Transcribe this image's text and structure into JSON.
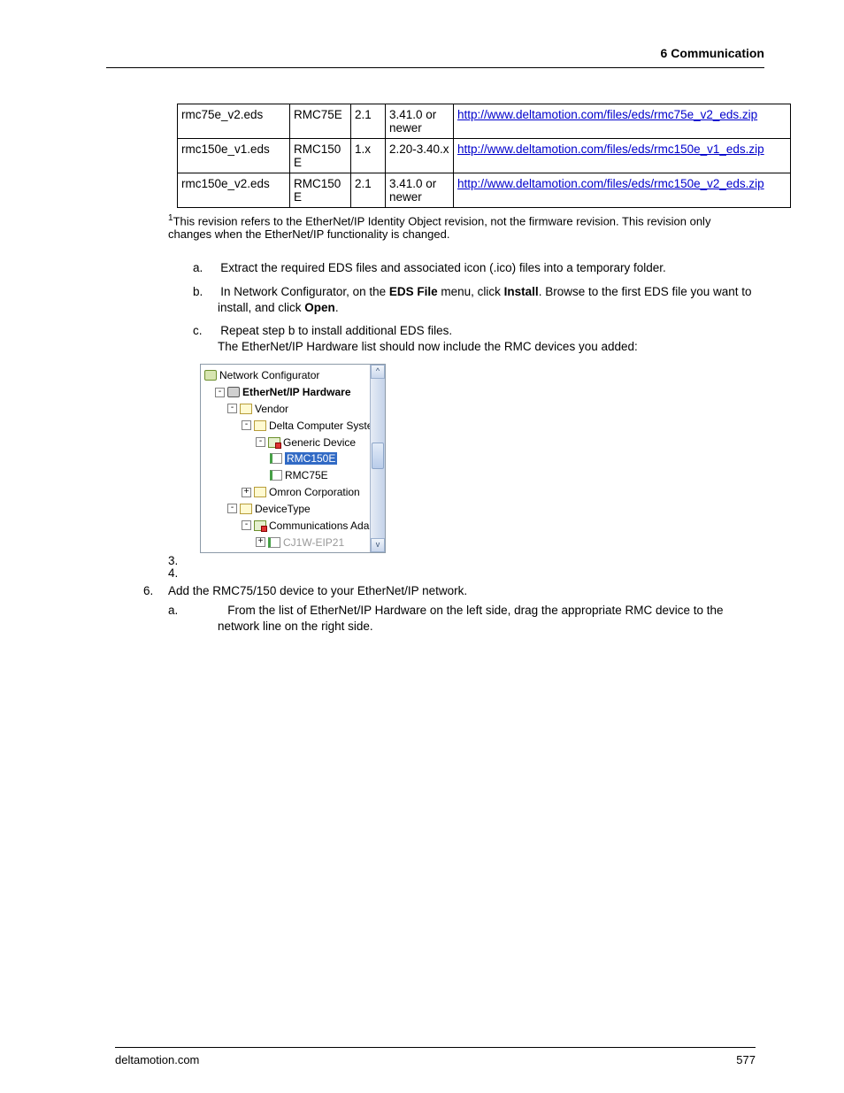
{
  "header": {
    "chapter": "6  Communication"
  },
  "table": {
    "rows": [
      {
        "file": "rmc75e_v2.eds",
        "device": "RMC75E",
        "rev": "2.1",
        "fw": "3.41.0 or newer",
        "url": "http://www.deltamotion.com/files/eds/rmc75e_v2_eds.zip"
      },
      {
        "file": "rmc150e_v1.eds",
        "device": "RMC150E",
        "rev": "1.x",
        "fw": "2.20-3.40.x",
        "url": "http://www.deltamotion.com/files/eds/rmc150e_v1_eds.zip"
      },
      {
        "file": "rmc150e_v2.eds",
        "device": "RMC150E",
        "rev": "2.1",
        "fw": "3.41.0 or newer",
        "url": "http://www.deltamotion.com/files/eds/rmc150e_v2_eds.zip"
      }
    ]
  },
  "footnote": "This revision refers to the EtherNet/IP Identity Object revision, not the firmware revision. This revision only changes when the EtherNet/IP functionality is changed.",
  "steps_abc": {
    "a": "Extract the required EDS files and associated icon (.ico) files into a temporary folder.",
    "b_pre": "In Network Configurator, on the ",
    "b_bold1": "EDS File",
    "b_mid": " menu, click ",
    "b_bold2": "Install",
    "b_post1": ". Browse to the first EDS file you want to install, and click ",
    "b_bold3": "Open",
    "b_post2": ".",
    "c_line1": "Repeat step b to install additional EDS files.",
    "c_line2": "The EtherNet/IP Hardware list should now include the RMC devices you added:"
  },
  "tree": {
    "root": "Network Configurator",
    "hw": "EtherNet/IP Hardware",
    "vendor": "Vendor",
    "delta": "Delta Computer Systems Inc",
    "generic": "Generic Device",
    "rmc150e": "RMC150E",
    "rmc75e": "RMC75E",
    "omron": "Omron Corporation",
    "devtype": "DeviceType",
    "comm": "Communications Adapter",
    "cut": "CJ1W-EIP21"
  },
  "stub3": "3.",
  "stub4": "4.",
  "step6": {
    "marker": "6.",
    "text": "Add the RMC75/150 device to your EtherNet/IP network.",
    "a": "From the list of EtherNet/IP Hardware on the left side, drag the appropriate RMC device to the network line on the right side."
  },
  "footer": {
    "left": "deltamotion.com",
    "right": "577"
  }
}
